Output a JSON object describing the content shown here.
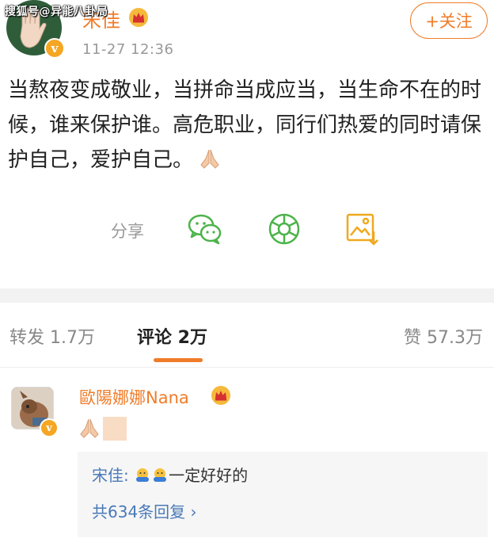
{
  "watermark": "搜狐号@异能八卦局",
  "post": {
    "username": "宋佳",
    "timestamp": "11-27 12:36",
    "follow_label": "+关注",
    "text": "当熬夜变成敬业，当拼命当成应当，当生命不在的时候，谁来保护谁。高危职业，同行们热爱的同时请保护自己，爱护自己。"
  },
  "share": {
    "label": "分享",
    "icons": [
      "wechat-icon",
      "moments-icon",
      "save-image-icon"
    ]
  },
  "tabs": {
    "repost": "转发 1.7万",
    "comment": "评论 2万",
    "like": "赞 57.3万"
  },
  "comment": {
    "username": "歐陽娜娜Nana",
    "reply": {
      "author": "宋佳:",
      "text": "一定好好的",
      "more": "共634条回复 ›"
    }
  },
  "colors": {
    "accent": "#f07c2a",
    "link": "#4a79b8",
    "wechat_green": "#4cb34a",
    "verified": "#f5a623"
  }
}
